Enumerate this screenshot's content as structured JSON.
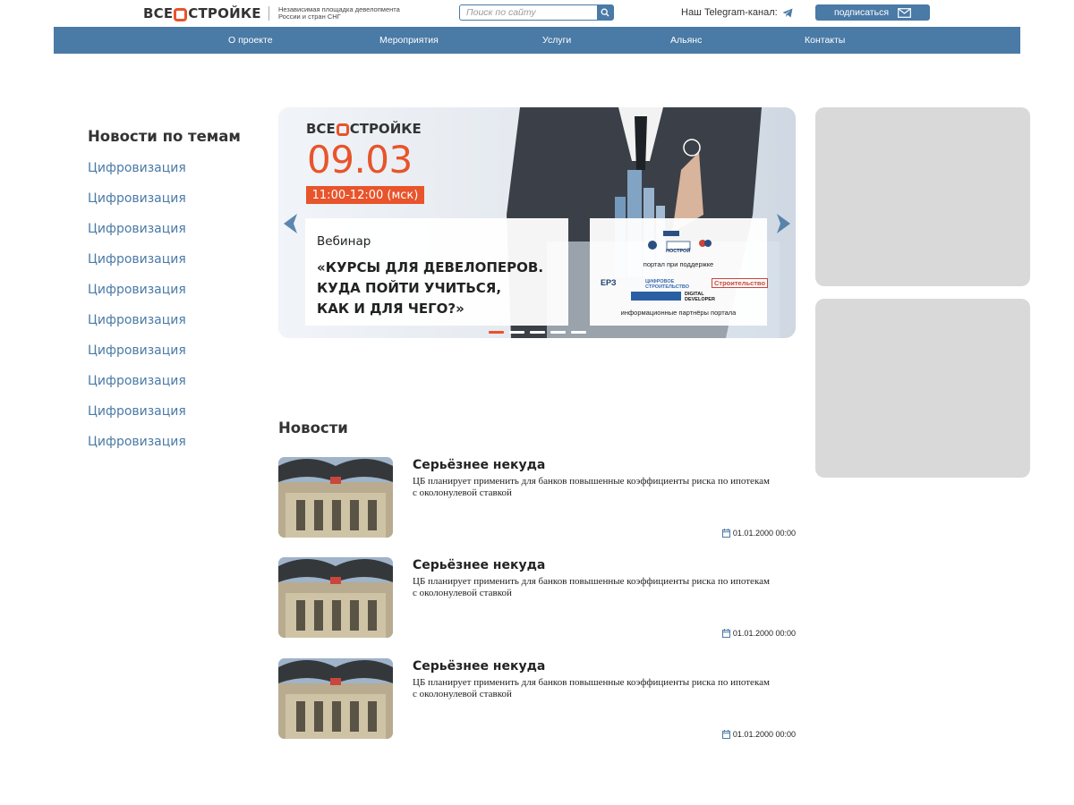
{
  "header": {
    "logo_left": "ВСЕ",
    "logo_right": "СТРОЙКЕ",
    "tagline": "Независимая площадка девелопмента России и стран СНГ",
    "search_placeholder": "Поиск по сайту",
    "telegram_label": "Наш Telegram-канал:",
    "subscribe_label": "подписаться"
  },
  "nav": {
    "items": [
      {
        "label": "О проекте"
      },
      {
        "label": "Мероприятия"
      },
      {
        "label": "Услуги"
      },
      {
        "label": "Альянс"
      },
      {
        "label": "Контакты"
      }
    ]
  },
  "sidebar": {
    "title": "Новости по темам",
    "items": [
      {
        "label": "Цифровизация"
      },
      {
        "label": "Цифровизация"
      },
      {
        "label": "Цифровизация"
      },
      {
        "label": "Цифровизация"
      },
      {
        "label": "Цифровизация"
      },
      {
        "label": "Цифровизация"
      },
      {
        "label": "Цифровизация"
      },
      {
        "label": "Цифровизация"
      },
      {
        "label": "Цифровизация"
      },
      {
        "label": "Цифровизация"
      }
    ]
  },
  "banner": {
    "logo_left": "ВСЕ",
    "logo_right": "СТРОЙКЕ",
    "date": "09.03",
    "time": "11:00-12:00 (мск)",
    "webinar": "Вебинар",
    "headline_1": "«КУРСЫ ДЛЯ ДЕВЕЛОПЕРОВ.",
    "headline_2": "КУДА ПОЙТИ УЧИТЬСЯ,",
    "headline_3": "КАК И ДЛЯ ЧЕГО?»",
    "support_label": "портал при поддержке",
    "partners_label": "информационные партнёры портала",
    "partner_logos": [
      "НОСТРОЙ",
      "ЕРЗ",
      "ЦИФРОВОЕ СТРОИТЕЛЬСТВО",
      "Строительство",
      "DIGITAL DEVELOPER"
    ],
    "slide_count": 5,
    "active_slide": 1
  },
  "news": {
    "title": "Новости",
    "items": [
      {
        "headline": "Серьёзнее некуда",
        "description": "ЦБ планирует применить для банков повышенные коэффициенты риска по ипотекам с околонулевой ставкой",
        "date": "01.01.2000 00:00"
      },
      {
        "headline": "Серьёзнее некуда",
        "description": "ЦБ планирует применить для банков повышенные коэффициенты риска по ипотекам с околонулевой ставкой",
        "date": "01.01.2000 00:00"
      },
      {
        "headline": "Серьёзнее некуда",
        "description": "ЦБ планирует применить для банков повышенные коэффициенты риска по ипотекам с околонулевой ставкой",
        "date": "01.01.2000 00:00"
      }
    ]
  },
  "colors": {
    "accent": "#4a7aa6",
    "brand_orange": "#e8542b",
    "ad_placeholder": "#d9d9d9"
  },
  "icons": {
    "search": "search-icon",
    "telegram": "telegram-icon",
    "mail": "mail-icon",
    "calendar": "calendar-icon",
    "prev": "chevron-left-icon",
    "next": "chevron-right-icon"
  }
}
